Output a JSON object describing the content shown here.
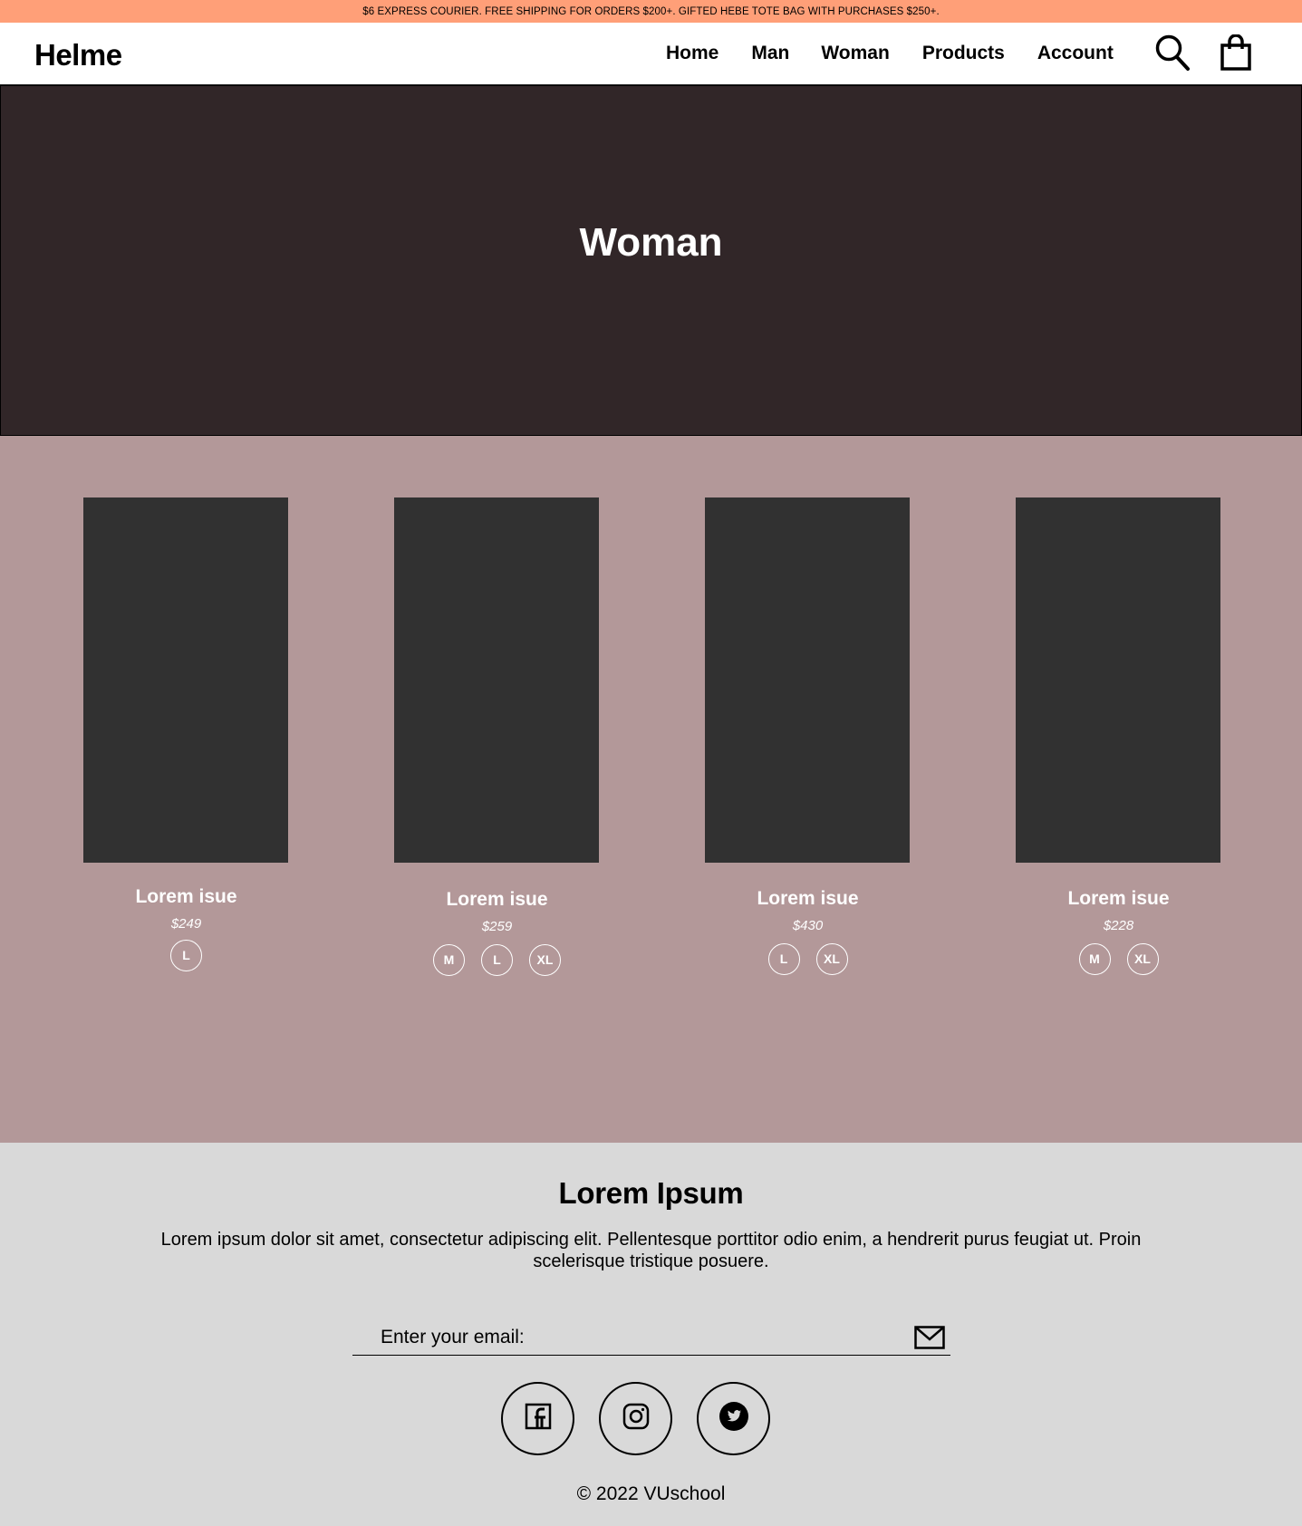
{
  "announcement": "$6 EXPRESS COURIER. FREE SHIPPING FOR ORDERS $200+. GIFTED HEBE TOTE BAG WITH PURCHASES $250+.",
  "header": {
    "logo": "Helme",
    "nav": [
      "Home",
      "Man",
      "Woman",
      "Products",
      "Account"
    ],
    "icons": [
      "search-icon",
      "shopping-bag-icon"
    ]
  },
  "hero": {
    "title": "Woman"
  },
  "products": [
    {
      "name": "Lorem isue",
      "price": "$249",
      "sizes": [
        "L"
      ]
    },
    {
      "name": "Lorem isue",
      "price": "$259",
      "sizes": [
        "M",
        "L",
        "XL"
      ]
    },
    {
      "name": "Lorem isue",
      "price": "$430",
      "sizes": [
        "L",
        "XL"
      ]
    },
    {
      "name": "Lorem isue",
      "price": "$228",
      "sizes": [
        "M",
        "XL"
      ]
    }
  ],
  "footer": {
    "title": "Lorem Ipsum",
    "lead": "Lorem ipsum dolor sit amet, consectetur adipiscing elit. Pellentesque porttitor odio enim, a hendrerit purus feugiat ut. Proin scelerisque tristique posuere.",
    "email_placeholder": "Enter your email:",
    "social": [
      "facebook-icon",
      "instagram-icon",
      "twitter-icon"
    ],
    "copyright": "© 2022 VUschool"
  },
  "colors": {
    "announcement_bg": "#ff9f78",
    "hero_bg": "#312628",
    "products_bg": "#b39899",
    "product_image": "#313131",
    "footer_bg": "#d9d9d9"
  }
}
